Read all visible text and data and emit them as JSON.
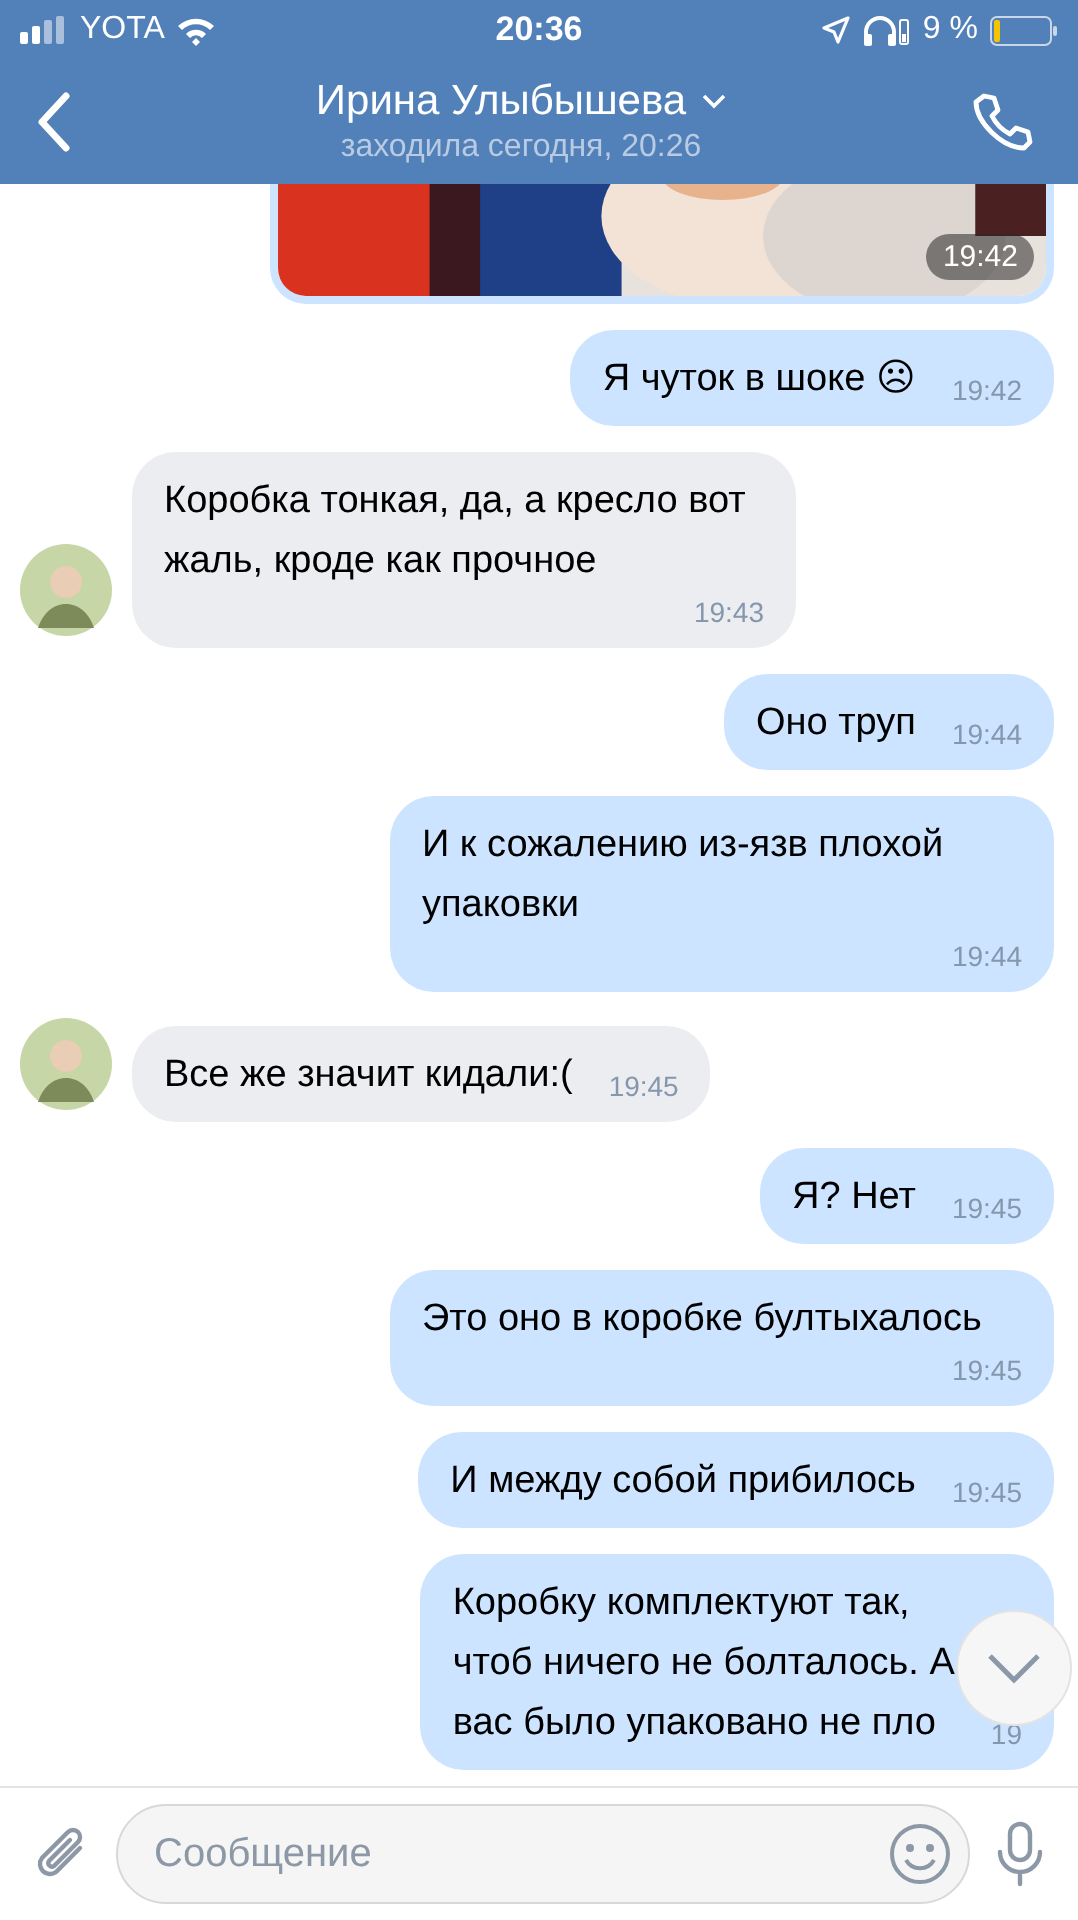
{
  "status_bar": {
    "carrier": "YOTA",
    "time": "20:36",
    "battery": "9 %"
  },
  "header": {
    "name": "Ирина Улыбышева",
    "status": "заходила сегодня, 20:26"
  },
  "messages": [
    {
      "outgoing": true,
      "time": "19:42"
    },
    {
      "kind": "text",
      "outgoing": true,
      "text": "Я чуток в шоке ☹",
      "time": "19:42"
    },
    {
      "kind": "text",
      "outgoing": false,
      "text": "Коробка тонкая, да, а кресло вот жаль, кроде как прочное",
      "time": "19:43"
    },
    {
      "kind": "text",
      "outgoing": true,
      "text": "Оно труп",
      "time": "19:44"
    },
    {
      "kind": "text",
      "outgoing": true,
      "text": "И к сожалению из-язв плохой упаковки",
      "time": "19:44"
    },
    {
      "kind": "text",
      "outgoing": false,
      "text": "Все же значит кидали:(",
      "time": "19:45"
    },
    {
      "kind": "text",
      "outgoing": true,
      "text": "Я? Нет",
      "time": "19:45"
    },
    {
      "kind": "text",
      "outgoing": true,
      "text": "Это оно в коробке бултыхалось",
      "time": "19:45"
    },
    {
      "kind": "text",
      "outgoing": true,
      "text": "И между собой прибилось",
      "time": "19:45"
    },
    {
      "kind": "text",
      "outgoing": true,
      "text": "Коробку комплектуют так,\nчтоб ничего не болталось. А\nвас было упаковано не пло",
      "time": "19"
    }
  ],
  "composer": {
    "placeholder": "Сообщение"
  }
}
